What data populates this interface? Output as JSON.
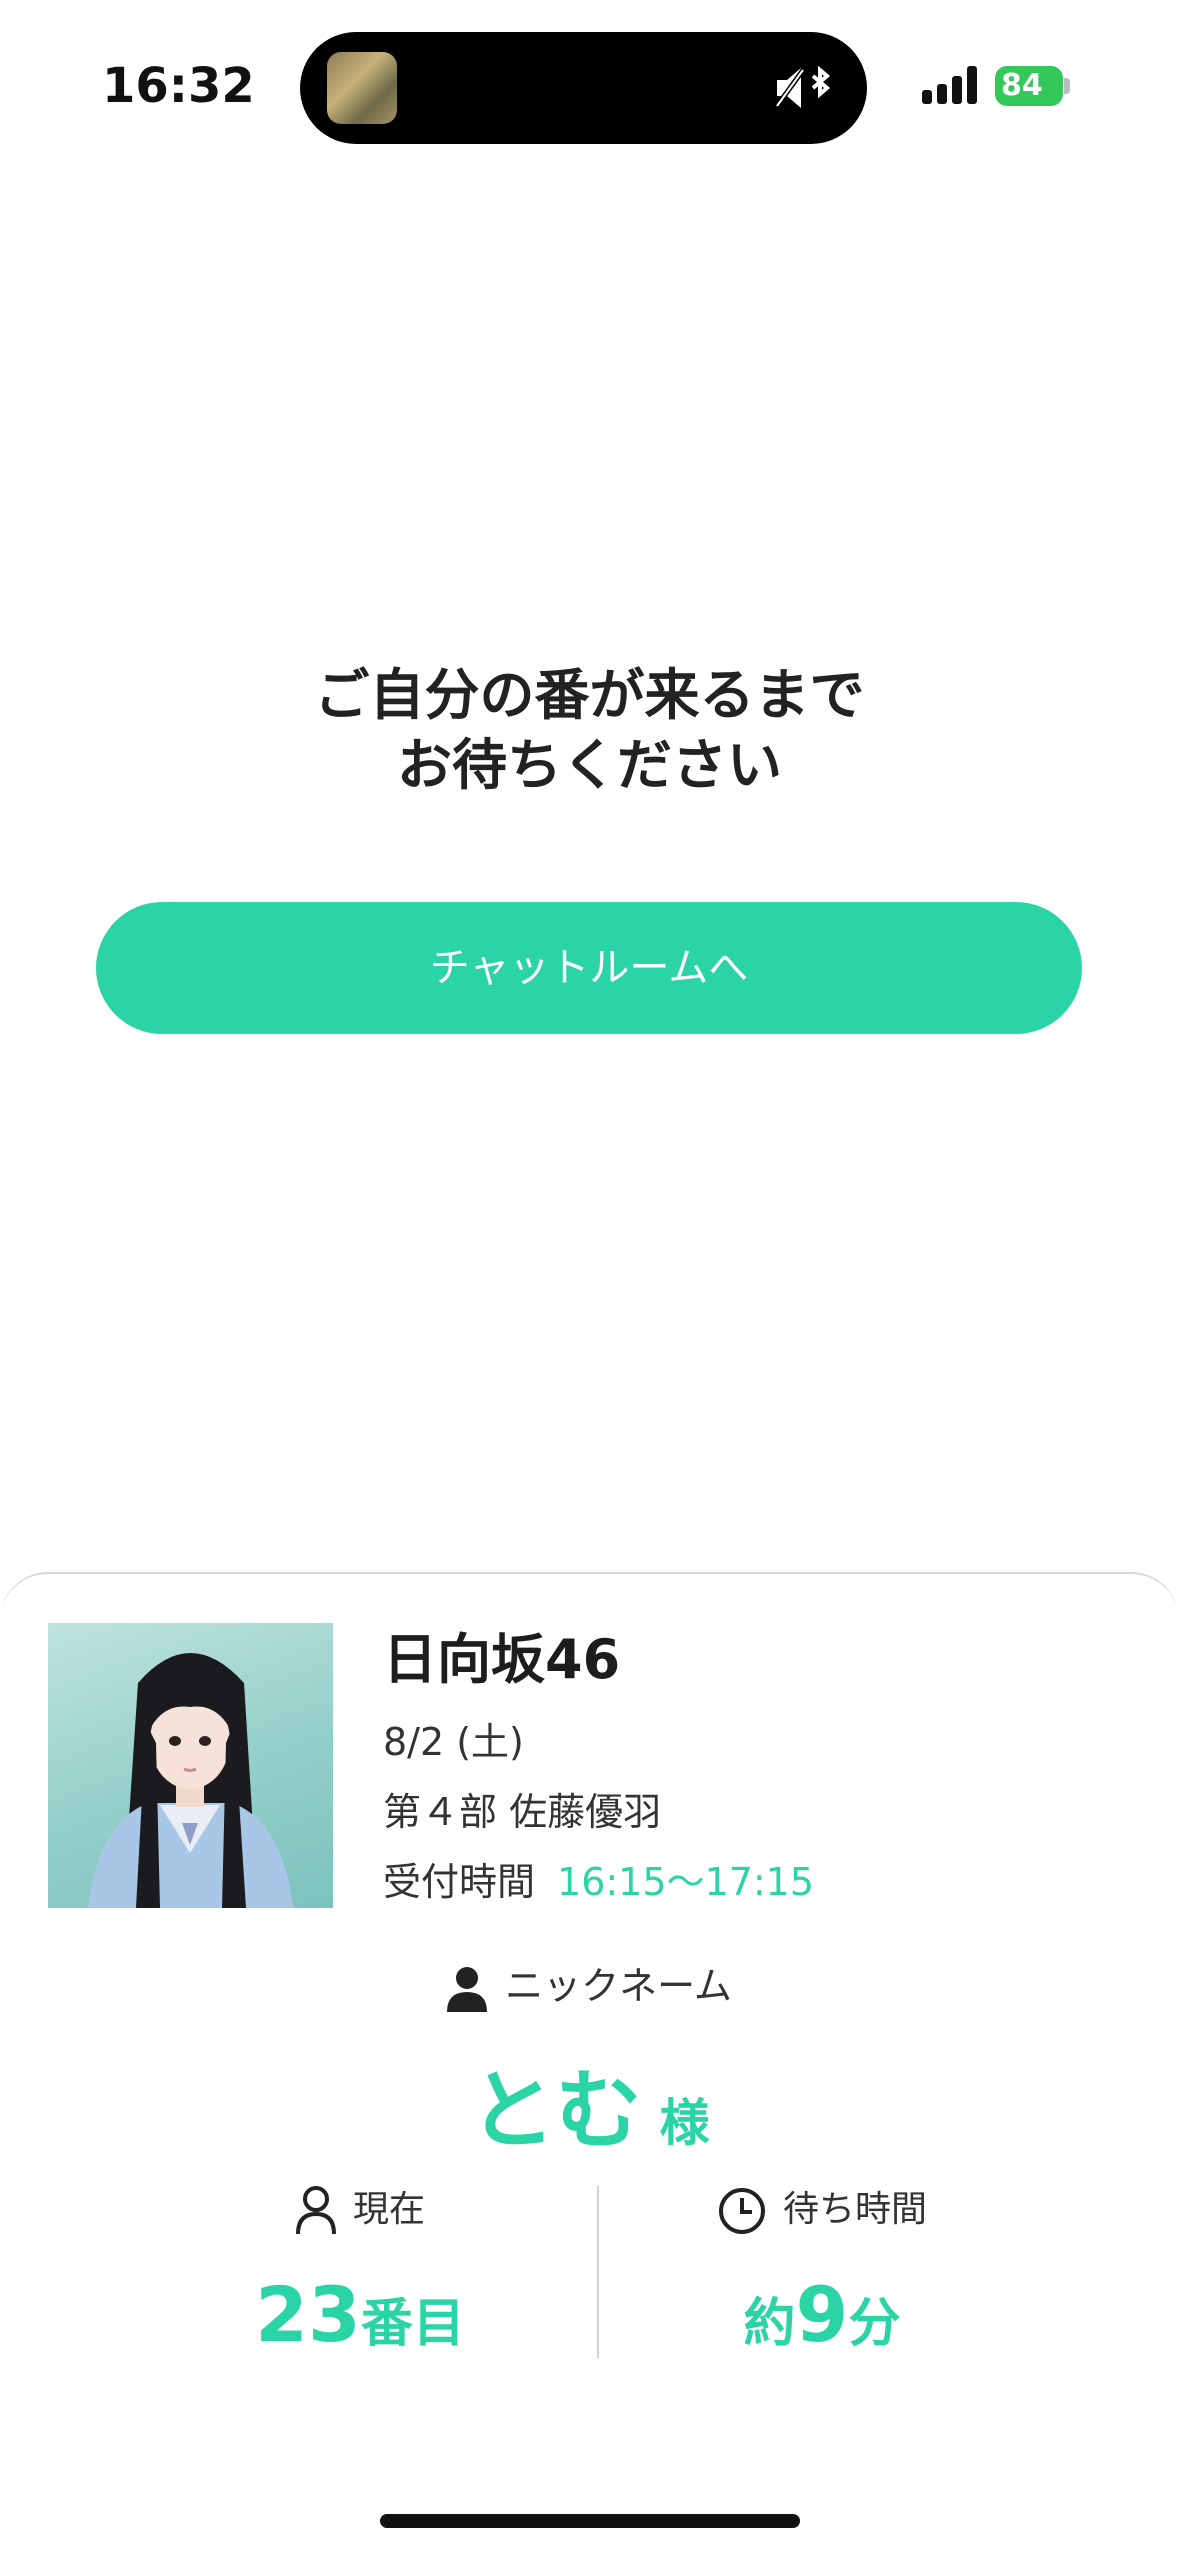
{
  "status_bar": {
    "time": "16:32",
    "battery": "84"
  },
  "message": {
    "line1": "ご自分の番が来るまで",
    "line2": "お待ちください"
  },
  "chat_button": {
    "label": "チャットルームへ"
  },
  "event": {
    "group": "日向坂46",
    "date": "8/2 (土)",
    "session_member": "第４部  佐藤優羽",
    "reception_label": "受付時間",
    "reception_time": "16:15〜17:15"
  },
  "nickname": {
    "label": "ニックネーム",
    "name": "とむ",
    "honorific": "様"
  },
  "queue": {
    "current_label": "現在",
    "current_number": "23",
    "current_unit": "番目",
    "wait_label": "待ち時間",
    "wait_prefix": "約",
    "wait_number": "9",
    "wait_unit": "分"
  },
  "colors": {
    "accent": "#2bd4a6",
    "battery": "#34c759"
  }
}
